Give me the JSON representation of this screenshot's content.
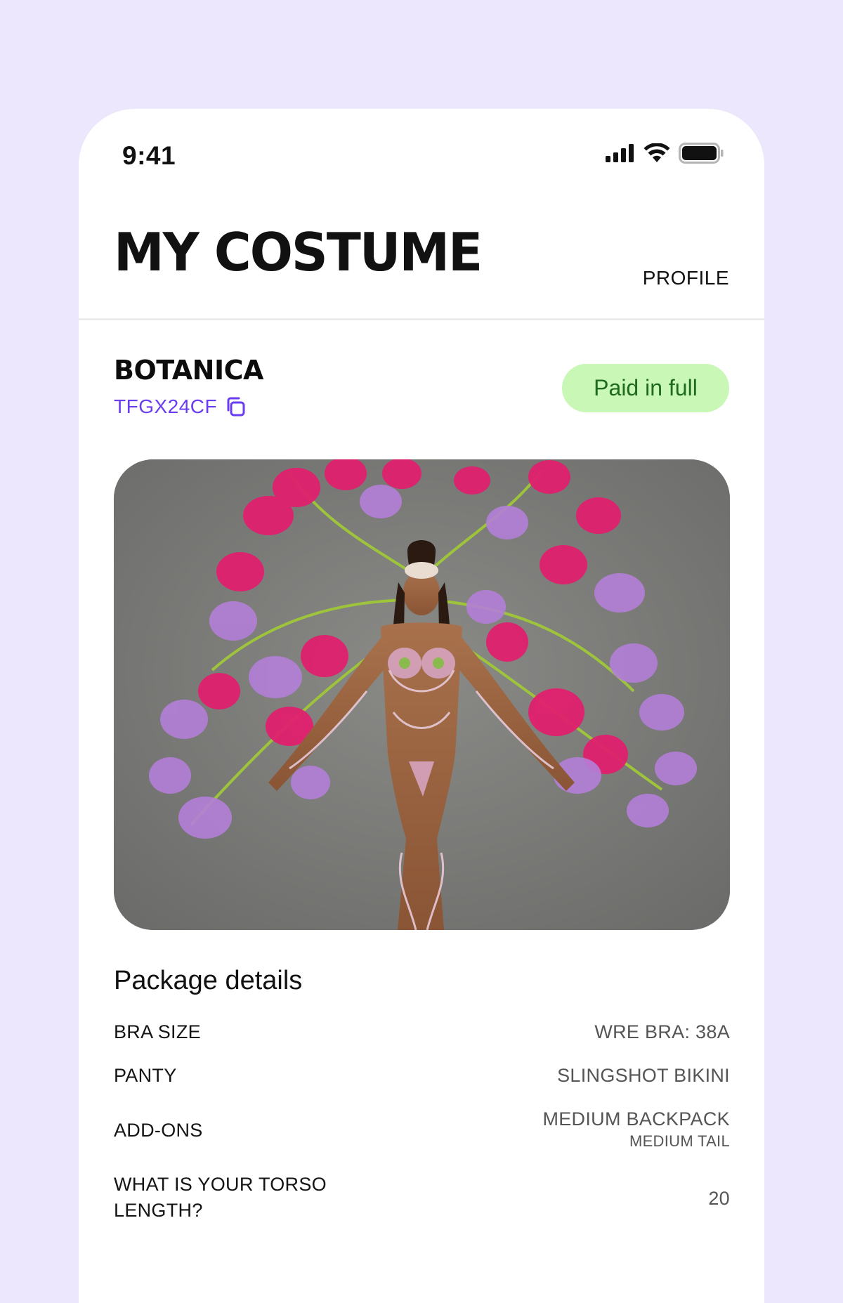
{
  "status_bar": {
    "time": "9:41",
    "icons": [
      "signal-icon",
      "wifi-icon",
      "battery-icon"
    ]
  },
  "header": {
    "title": "MY COSTUME",
    "profile_link": "PROFILE"
  },
  "costume": {
    "name": "BOTANICA",
    "code": "TFGX24CF",
    "copy_icon": "copy-icon",
    "status": "Paid in full"
  },
  "package": {
    "title": "Package details",
    "rows": [
      {
        "label": "BRA SIZE",
        "value": "WRE BRA: 38A"
      },
      {
        "label": "PANTY",
        "value": "SLINGSHOT BIKINI"
      },
      {
        "label": "ADD-ONS",
        "value": "MEDIUM BACKPACK",
        "sub": "MEDIUM TAIL"
      },
      {
        "label_line1": "WHAT IS YOUR TORSO",
        "label_line2": "LENGTH?",
        "value": "20"
      }
    ]
  },
  "colors": {
    "background": "#ECE7FD",
    "accent": "#6A3DF0",
    "badge_bg": "#C8F7B6",
    "badge_text": "#1F6A1C"
  }
}
